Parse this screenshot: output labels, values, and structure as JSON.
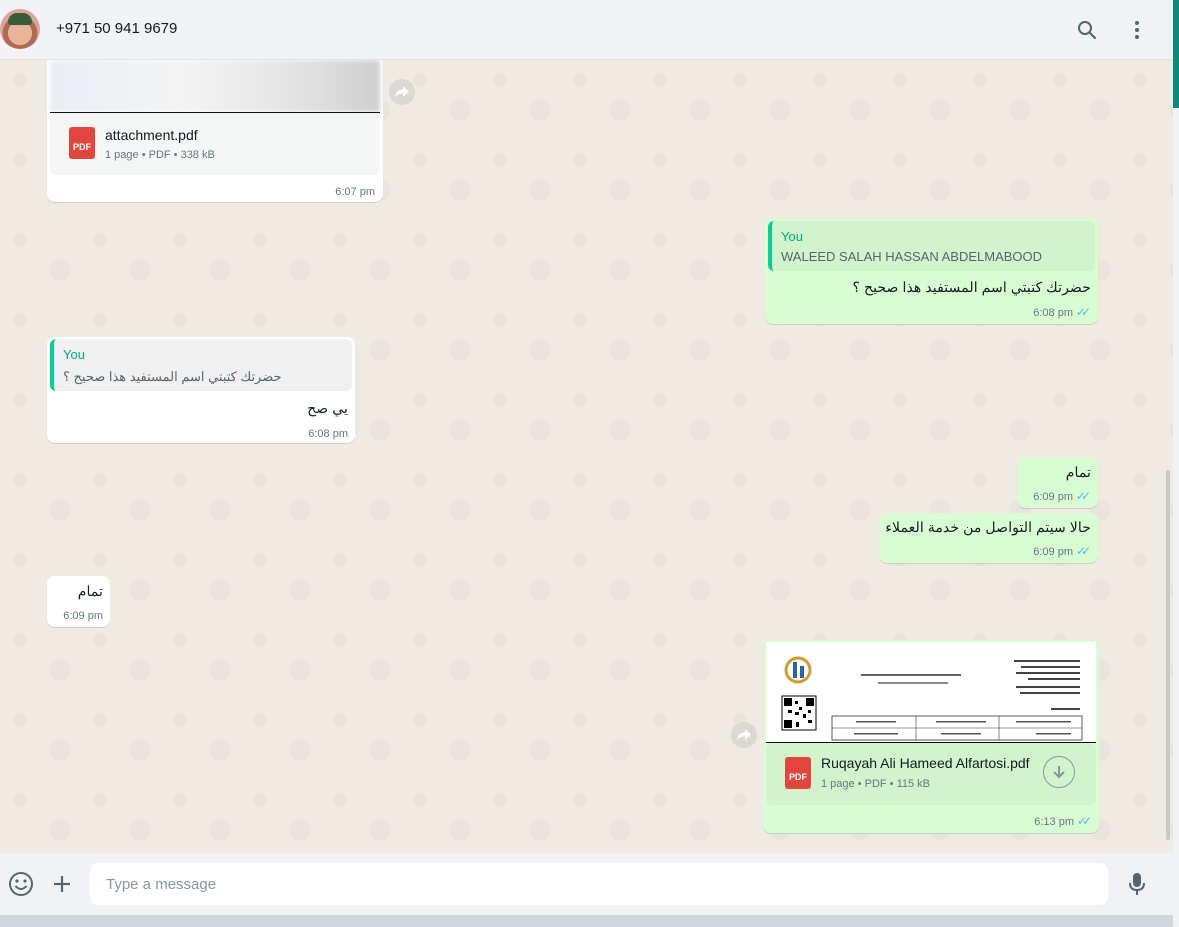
{
  "header": {
    "contact_name": "+971 50 941 9679",
    "icons": [
      "avatar",
      "search-icon",
      "menu-icon"
    ]
  },
  "messages": [
    {
      "id": "m1",
      "direction": "incoming",
      "doc_name": "attachment.pdf",
      "doc_meta": "1 page • PDF • 338 kB",
      "pdf_label": "PDF",
      "time": "6:07 pm"
    },
    {
      "id": "m2",
      "direction": "outgoing",
      "quote_author": "You",
      "quote_text": "WALEED SALAH HASSAN ABDELMABOOD",
      "text": "حضرتك كتبتي اسم المستفيد هذا صحيح ؟",
      "time": "6:08 pm",
      "status": "read"
    },
    {
      "id": "m3",
      "direction": "incoming",
      "quote_author": "You",
      "quote_text": "حضرتك كتبتي اسم المستفيد هذا صحيح ؟",
      "text": "يي صح",
      "time": "6:08 pm"
    },
    {
      "id": "m4",
      "direction": "outgoing",
      "text": "تمام",
      "time": "6:09 pm",
      "status": "read"
    },
    {
      "id": "m5",
      "direction": "outgoing",
      "text": "حالا سيتم التواصل من خدمة العملاء",
      "time": "6:09 pm",
      "status": "read"
    },
    {
      "id": "m6",
      "direction": "incoming",
      "text": "تمام",
      "time": "6:09 pm"
    },
    {
      "id": "m7",
      "direction": "outgoing",
      "doc_name": "Ruqayah Ali Hameed Alfartosi.pdf",
      "doc_meta": "1 page • PDF • 115 kB",
      "pdf_label": "PDF",
      "time": "6:13 pm",
      "status": "read"
    }
  ],
  "composer": {
    "placeholder": "Type a message",
    "icons": [
      "emoji-icon",
      "plus-icon",
      "mic-icon"
    ]
  },
  "colors": {
    "accent": "#06cf9c",
    "outgoing_bubble": "#d9fdd3",
    "incoming_bubble": "#ffffff",
    "read_ticks": "#53bdeb",
    "pdf_red": "#e2453c"
  }
}
